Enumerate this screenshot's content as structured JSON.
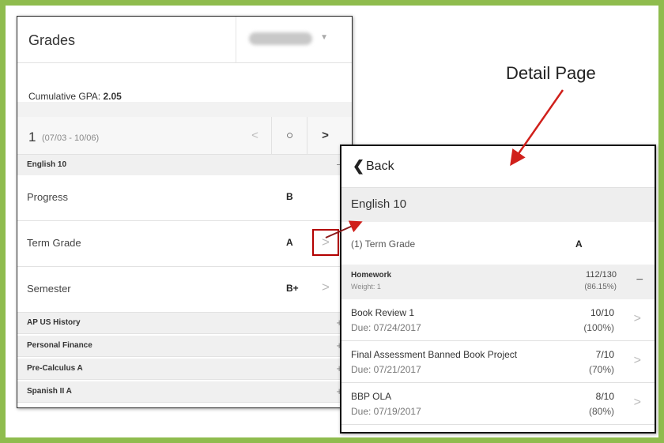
{
  "annotation": {
    "label": "Detail Page",
    "accent": "#d0201b"
  },
  "grades": {
    "title": "Grades",
    "gpa_label": "Cumulative GPA:",
    "gpa_value": "2.05",
    "term": {
      "number": "1",
      "dates": "(07/03 - 10/06)",
      "prev_icon": "<",
      "current_icon": "○",
      "next_icon": ">"
    },
    "expanded_course": {
      "name": "English 10",
      "toggle": "−",
      "rows": [
        {
          "label": "Progress",
          "grade": "B"
        },
        {
          "label": "Term Grade",
          "grade": "A"
        },
        {
          "label": "Semester",
          "grade": "B+"
        }
      ]
    },
    "collapsed_courses": [
      {
        "name": "AP US History",
        "toggle": "+"
      },
      {
        "name": "Personal Finance",
        "toggle": "+"
      },
      {
        "name": "Pre-Calculus A",
        "toggle": "+"
      },
      {
        "name": "Spanish II A",
        "toggle": "+"
      }
    ]
  },
  "detail": {
    "back_label": "Back",
    "course": "English 10",
    "term_label": "(1) Term Grade",
    "term_grade": "A",
    "category": {
      "name": "Homework",
      "weight": "Weight: 1",
      "score": "112/130",
      "percent": "(86.15%)",
      "toggle": "−"
    },
    "assignments": [
      {
        "name": "Book Review 1",
        "due": "Due: 07/24/2017",
        "score": "10/10",
        "percent": "(100%)"
      },
      {
        "name": "Final Assessment Banned Book Project",
        "due": "Due: 07/21/2017",
        "score": "7/10",
        "percent": "(70%)"
      },
      {
        "name": "BBP OLA",
        "due": "Due: 07/19/2017",
        "score": "8/10",
        "percent": "(80%)"
      }
    ]
  }
}
